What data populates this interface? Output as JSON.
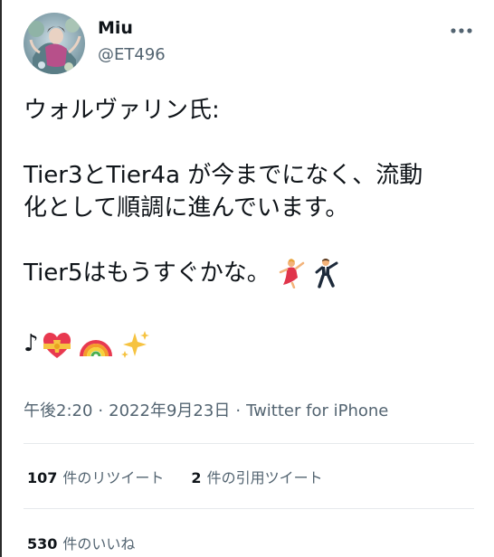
{
  "author": {
    "name": "Miu",
    "handle": "@ET496",
    "avatar": "avatar-illustration"
  },
  "menu_icon": "more-dots-icon",
  "tweet": {
    "lines": [
      "ウォルヴァリン氏:",
      "",
      "Tier3とTier4a が今までになく、流動",
      "化として順調に進んでいます。",
      "",
      "Tier5はもうすぐかな。"
    ],
    "emoji_after_last_line": [
      "dancer-emoji",
      "man-dancing-emoji"
    ],
    "final_line_prefix": "♪",
    "final_line_emoji": [
      "heart-ribbon-emoji",
      "rainbow-emoji",
      "sparkles-emoji"
    ]
  },
  "meta": {
    "time": "午後2:20",
    "date": "2022年9月23日",
    "source": "Twitter for iPhone",
    "separator": "·"
  },
  "stats": {
    "retweets_count": "107",
    "retweets_label": "件のリツイート",
    "quotes_count": "2",
    "quotes_label": "件の引用ツイート",
    "likes_count": "530",
    "likes_label": "件のいいね"
  },
  "colors": {
    "text": "#0f1419",
    "secondary": "#536471",
    "divider": "#e6e9ec"
  }
}
